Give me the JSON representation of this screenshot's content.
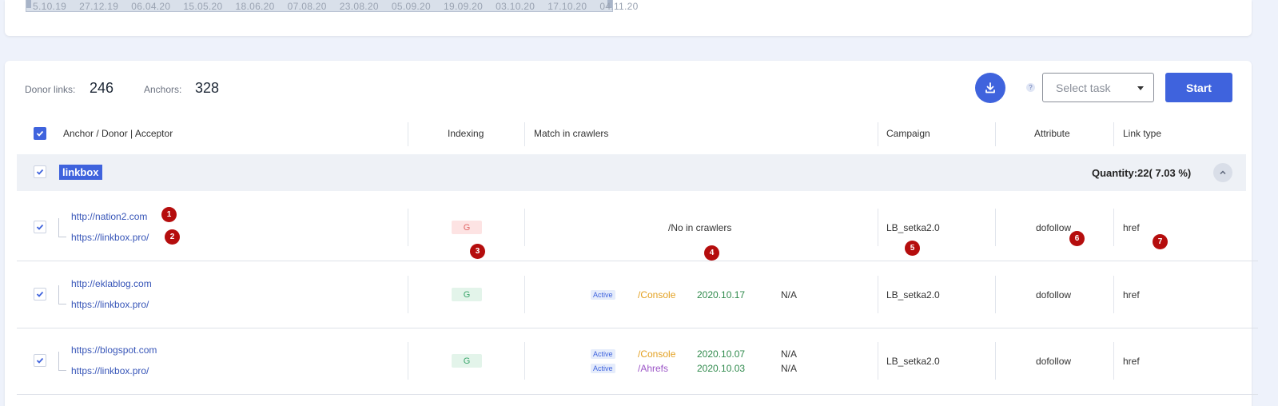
{
  "timeline": {
    "dates": [
      "5.10.19",
      "27.12.19",
      "06.04.20",
      "15.05.20",
      "18.06.20",
      "07.08.20",
      "23.08.20",
      "05.09.20",
      "19.09.20",
      "03.10.20",
      "17.10.20",
      "04.11.20"
    ]
  },
  "stats": {
    "donor_label": "Donor links:",
    "donor_value": "246",
    "anchors_label": "Anchors:",
    "anchors_value": "328"
  },
  "toolbar": {
    "help": "?",
    "select_placeholder": "Select task",
    "start_label": "Start"
  },
  "columns": {
    "anchor": "Anchor / Donor | Acceptor",
    "indexing": "Indexing",
    "match": "Match in crawlers",
    "campaign": "Campaign",
    "attribute": "Attribute",
    "link_type": "Link type"
  },
  "group": {
    "name": "linkbox",
    "quantity": "Quantity:22( 7.03 %)"
  },
  "rows": [
    {
      "donor": "http://nation2.com",
      "acceptor": "https://linkbox.pro/",
      "indexing": "G",
      "crawler_note": "/No in crawlers",
      "campaign": "LB_setka2.0",
      "attribute": "dofollow",
      "link_type": "href"
    },
    {
      "donor": "http://eklablog.com",
      "acceptor": "https://linkbox.pro/",
      "indexing": "G",
      "crawlers": [
        {
          "status": "Active",
          "name": "/Console",
          "date": "2020.10.17",
          "value": "N/A"
        }
      ],
      "campaign": "LB_setka2.0",
      "attribute": "dofollow",
      "link_type": "href"
    },
    {
      "donor": "https://blogspot.com",
      "acceptor": "https://linkbox.pro/",
      "indexing": "G",
      "crawlers": [
        {
          "status": "Active",
          "name": "/Console",
          "date": "2020.10.07",
          "value": "N/A"
        },
        {
          "status": "Active",
          "name": "/Ahrefs",
          "date": "2020.10.03",
          "value": "N/A"
        }
      ],
      "campaign": "LB_setka2.0",
      "attribute": "dofollow",
      "link_type": "href"
    }
  ],
  "markers": [
    "1",
    "2",
    "3",
    "4",
    "5",
    "6",
    "7"
  ],
  "colors": {
    "accent": "#3f63dd",
    "marker": "#b50d0d",
    "console": "#e3a020",
    "ahrefs": "#9c56c7",
    "date": "#2f8a4c"
  }
}
